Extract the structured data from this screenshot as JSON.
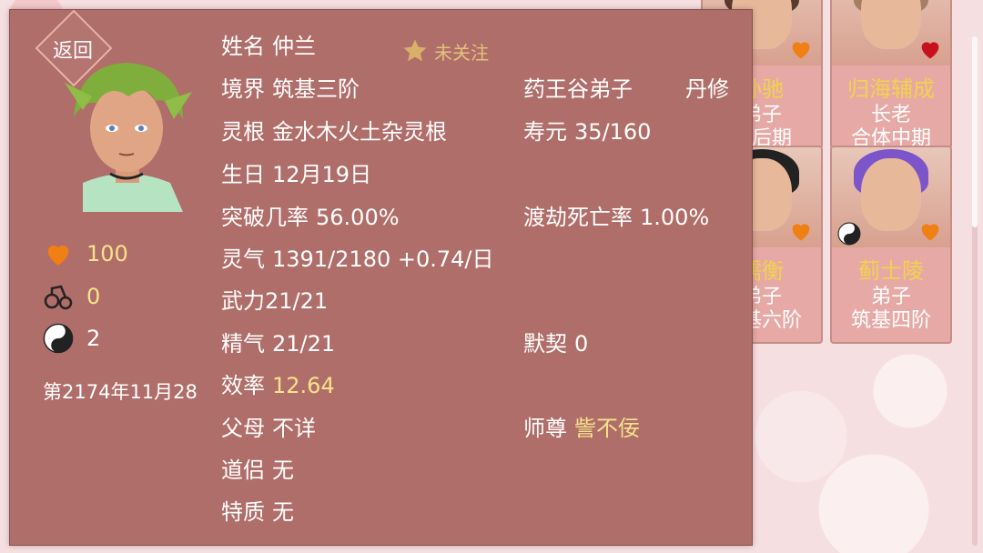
{
  "back_label": "返回",
  "follow": {
    "label": "未关注"
  },
  "character": {
    "name_label": "姓名",
    "name": "仲兰",
    "realm_label": "境界",
    "realm": "筑基三阶",
    "sect": "药王谷弟子",
    "profession": "丹修",
    "root_label": "灵根",
    "root": "金水木火土杂灵根",
    "lifespan_label": "寿元",
    "lifespan": "35/160",
    "birthday_label": "生日",
    "birthday": "12月19日",
    "breakthrough_label": "突破几率",
    "breakthrough": "56.00%",
    "tribulation_label": "渡劫死亡率",
    "tribulation": "1.00%",
    "qi_label": "灵气",
    "qi": "1391/2180 +0.74/日",
    "force_label": "武力",
    "force": "21/21",
    "essence_label": "精气",
    "essence": "21/21",
    "tacit_label": "默契",
    "tacit": "0",
    "efficiency_label": "效率",
    "efficiency": "12.64",
    "parents_label": "父母",
    "parents": "不详",
    "master_label": "师尊",
    "master": "訾不佞",
    "partner_label": "道侣",
    "partner": "无",
    "traits_label": "特质",
    "traits": "无"
  },
  "stats": {
    "affection": "100",
    "shackle": "0",
    "yinyang": "2"
  },
  "date": "第2174年11月28",
  "cards": [
    {
      "name": "孙驰",
      "role": "弟子",
      "rank": "丹后期",
      "heart": "#f07f14",
      "hair": "#5a3a2a"
    },
    {
      "name": "归海辅成",
      "role": "长老",
      "rank": "合体中期",
      "heart": "#c8101c",
      "hair": "#a57e63"
    },
    {
      "name": "儒衡",
      "role": "弟子",
      "rank": "筑基六阶",
      "heart": "#f07f14",
      "hair": "#222222"
    },
    {
      "name": "蓟士陵",
      "role": "弟子",
      "rank": "筑基四阶",
      "heart": "#f07f14",
      "hair": "#7b55c9"
    }
  ],
  "colors": {
    "panel": "#b06e6a",
    "accent_yellow": "#f5e38a",
    "heart_orange": "#f07f14"
  }
}
